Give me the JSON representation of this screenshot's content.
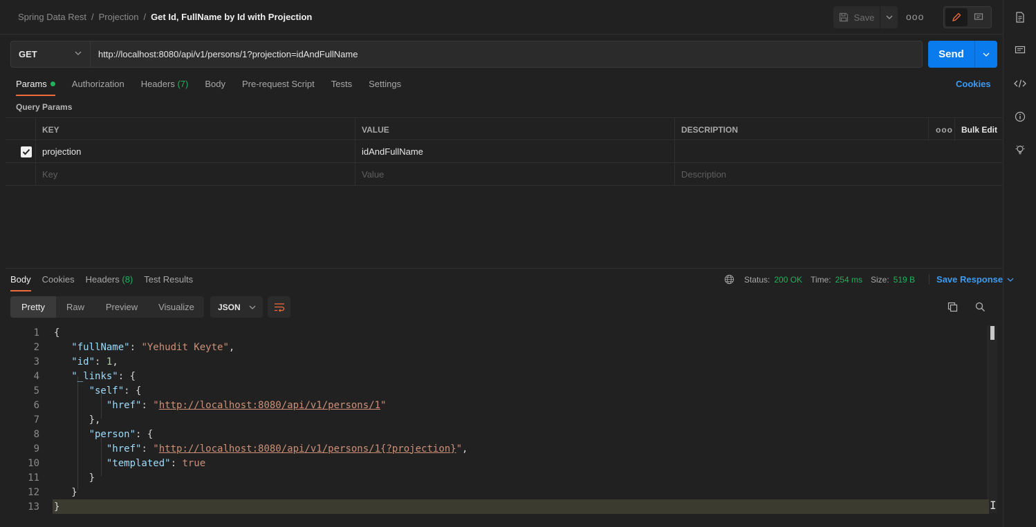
{
  "header": {
    "breadcrumbs": [
      "Spring Data Rest",
      "Projection"
    ],
    "separator": "/",
    "title": "Get Id, FullName by Id with Projection",
    "save_label": "Save",
    "more_label": "ooo"
  },
  "request": {
    "method": "GET",
    "url": "http://localhost:8080/api/v1/persons/1?projection=idAndFullName",
    "send_label": "Send"
  },
  "request_tabs": {
    "params": "Params",
    "authorization": "Authorization",
    "headers": "Headers",
    "headers_count": "(7)",
    "body": "Body",
    "prerequest": "Pre-request Script",
    "tests": "Tests",
    "settings": "Settings",
    "cookies": "Cookies"
  },
  "query_params": {
    "title": "Query Params",
    "columns": {
      "key": "KEY",
      "value": "VALUE",
      "description": "DESCRIPTION",
      "more": "ooo",
      "bulk_edit": "Bulk Edit"
    },
    "rows": [
      {
        "key": "projection",
        "value": "idAndFullName",
        "description": ""
      }
    ],
    "placeholders": {
      "key": "Key",
      "value": "Value",
      "description": "Description"
    }
  },
  "response": {
    "tabs": {
      "body": "Body",
      "cookies": "Cookies",
      "headers": "Headers",
      "headers_count": "(8)",
      "test_results": "Test Results"
    },
    "status_label": "Status:",
    "status_value": "200 OK",
    "time_label": "Time:",
    "time_value": "254 ms",
    "size_label": "Size:",
    "size_value": "519 B",
    "save_response": "Save Response",
    "views": [
      "Pretty",
      "Raw",
      "Preview",
      "Visualize"
    ],
    "format": "JSON",
    "lines": [
      "1",
      "2",
      "3",
      "4",
      "5",
      "6",
      "7",
      "8",
      "9",
      "10",
      "11",
      "12",
      "13"
    ],
    "json": {
      "open": "{",
      "close": "}",
      "fullName_key": "\"fullName\"",
      "fullName_val": "\"Yehudit Keyte\"",
      "id_key": "\"id\"",
      "id_val": "1",
      "links_key": "\"_links\"",
      "self_key": "\"self\"",
      "href_key": "\"href\"",
      "self_href": "http://localhost:8080/api/v1/persons/1",
      "person_key": "\"person\"",
      "person_href": "http://localhost:8080/api/v1/persons/1{?projection}",
      "templated_key": "\"templated\"",
      "templated_val": "true"
    }
  },
  "icons": {
    "save": "save-icon",
    "edit": "pencil-icon",
    "comment": "comment-icon",
    "doc": "document-icon",
    "code": "code-icon",
    "info": "info-icon",
    "bulb": "lightbulb-icon",
    "globe": "globe-icon",
    "copy": "copy-icon",
    "search": "search-icon",
    "wrap": "wrap-icon"
  },
  "colors": {
    "accent": "#f26b3a",
    "primary": "#097bed",
    "success": "#1fb35c",
    "link": "#3d9bf0"
  }
}
